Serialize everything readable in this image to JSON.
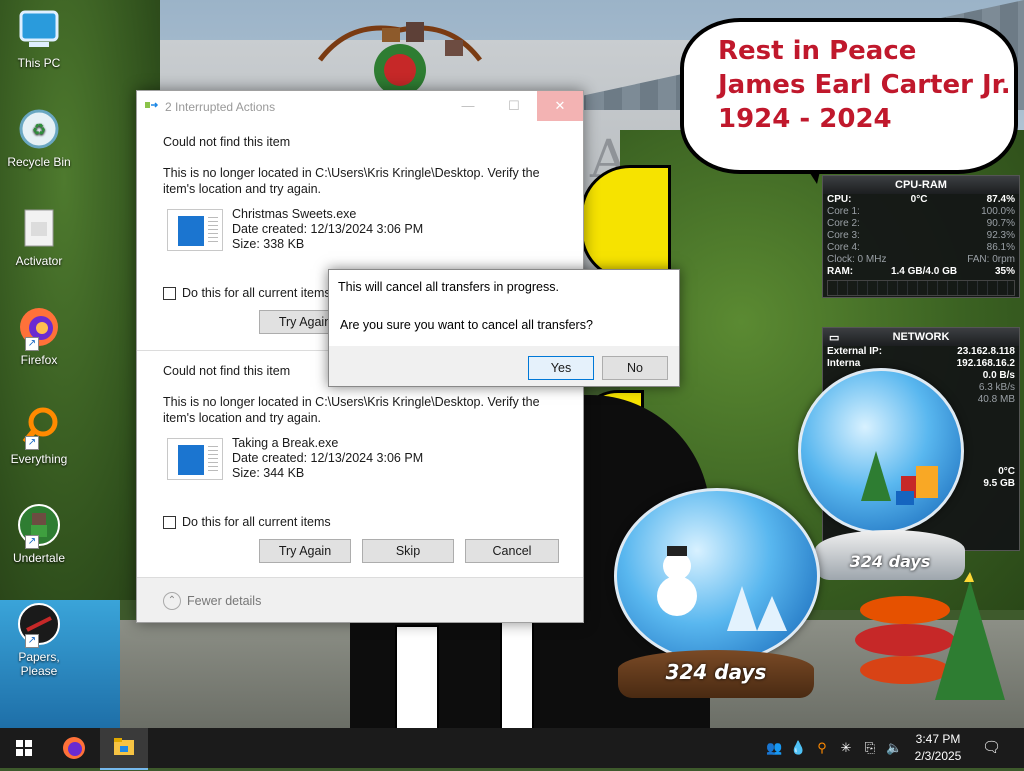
{
  "desktop_icons": [
    {
      "label": "This PC",
      "icon": "computer-icon"
    },
    {
      "label": "Recycle Bin",
      "icon": "recycle-bin-icon"
    },
    {
      "label": "Activator",
      "icon": "document-icon"
    },
    {
      "label": "Firefox",
      "icon": "firefox-icon"
    },
    {
      "label": "Everything",
      "icon": "magnifier-icon"
    },
    {
      "label": "Undertale",
      "icon": "undertale-icon"
    },
    {
      "label": "Papers, Please",
      "icon": "papers-please-icon"
    }
  ],
  "wallpaper": {
    "speech_lines": [
      "Rest in Peace",
      "James Earl Carter Jr.",
      "1924 - 2024"
    ],
    "building_text": "AL"
  },
  "main_dialog": {
    "title": "2 Interrupted Actions",
    "items": [
      {
        "heading": "Could not find this item",
        "message": "This is no longer located in C:\\Users\\Kris Kringle\\Desktop. Verify the item's location and try again.",
        "file_name": "Christmas Sweets.exe",
        "date_created": "Date created: 12/13/2024 3:06 PM",
        "size": "Size: 338 KB",
        "checkbox_label": "Do this for all current items",
        "try_again": "Try Again"
      },
      {
        "heading": "Could not find this item",
        "message": "This is no longer located in C:\\Users\\Kris Kringle\\Desktop. Verify the item's location and try again.",
        "file_name": "Taking a Break.exe",
        "date_created": "Date created: 12/13/2024 3:06 PM",
        "size": "Size: 344 KB",
        "checkbox_label": "Do this for all current items",
        "try_again": "Try Again",
        "skip": "Skip",
        "cancel": "Cancel"
      }
    ],
    "fewer_details": "Fewer details"
  },
  "confirm_dialog": {
    "message1": "This will cancel all transfers in progress.",
    "message2": "Are you sure you want to cancel all transfers?",
    "yes": "Yes",
    "no": "No"
  },
  "cpu_gadget": {
    "title": "CPU-RAM",
    "cpu_label": "CPU:",
    "cpu_temp": "0°C",
    "cpu_pct": "87.4%",
    "cores": [
      {
        "label": "Core 1:",
        "value": "100.0%"
      },
      {
        "label": "Core 2:",
        "value": "90.7%"
      },
      {
        "label": "Core 3:",
        "value": "92.3%"
      },
      {
        "label": "Core 4:",
        "value": "86.1%"
      }
    ],
    "clock": "Clock: 0 MHz",
    "fan": "FAN: 0rpm",
    "ram_label": "RAM:",
    "ram_value": "1.4 GB/4.0 GB",
    "ram_pct": "35%"
  },
  "network_gadget": {
    "title": "NETWORK",
    "ext_ip_label": "External IP:",
    "ext_ip": "23.162.8.118",
    "int_ip_label": "Interna",
    "int_ip": "192.168.16.2",
    "rate1": "0.0 B/s",
    "rate2": "6.3 kB/s",
    "total": "40.8 MB",
    "temp": "0°C",
    "disk": "9.5 GB"
  },
  "snow_globes": [
    {
      "label": "324 days"
    },
    {
      "label": "324 days"
    }
  ],
  "taskbar": {
    "time": "3:47 PM",
    "date": "2/3/2025",
    "apps": [
      "windows-start-icon",
      "firefox-icon",
      "file-explorer-icon"
    ],
    "tray": [
      "people-icon",
      "drop-icon",
      "search-icon",
      "snowflake-icon",
      "network-icon",
      "volume-icon"
    ]
  }
}
